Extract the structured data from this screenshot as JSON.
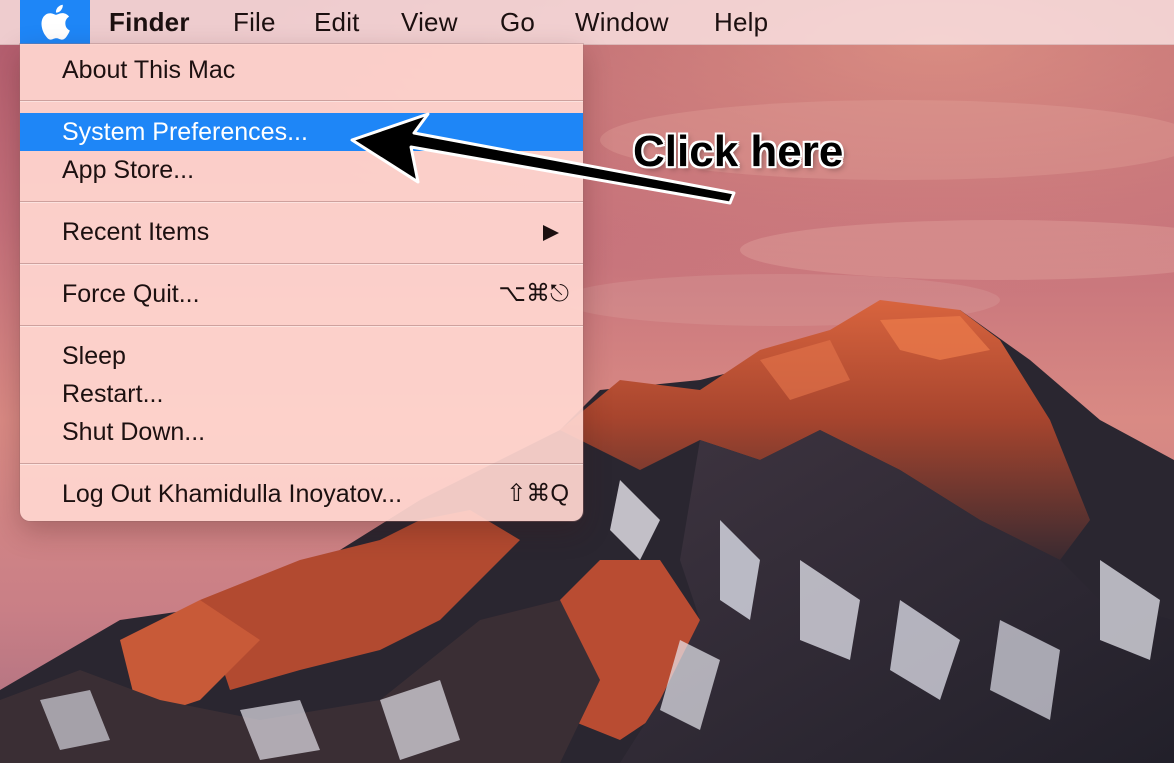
{
  "menubar": {
    "apple_icon": "apple-logo-icon",
    "items": [
      "Finder",
      "File",
      "Edit",
      "View",
      "Go",
      "Window",
      "Help"
    ]
  },
  "apple_menu": {
    "about": "About This Mac",
    "system_preferences": "System Preferences...",
    "app_store": "App Store...",
    "recent_items": "Recent Items",
    "force_quit": "Force Quit...",
    "force_quit_shortcut": "⌥⌘⎋",
    "sleep": "Sleep",
    "restart": "Restart...",
    "shut_down": "Shut Down...",
    "log_out": "Log Out Khamidulla Inoyatov...",
    "log_out_shortcut": "⇧⌘Q",
    "highlighted_item": "System Preferences..."
  },
  "annotation": {
    "text": "Click here"
  },
  "colors": {
    "highlight": "#1e86f7",
    "menu_background": "#ffd6d0",
    "menubar_background": "#f8dede"
  }
}
